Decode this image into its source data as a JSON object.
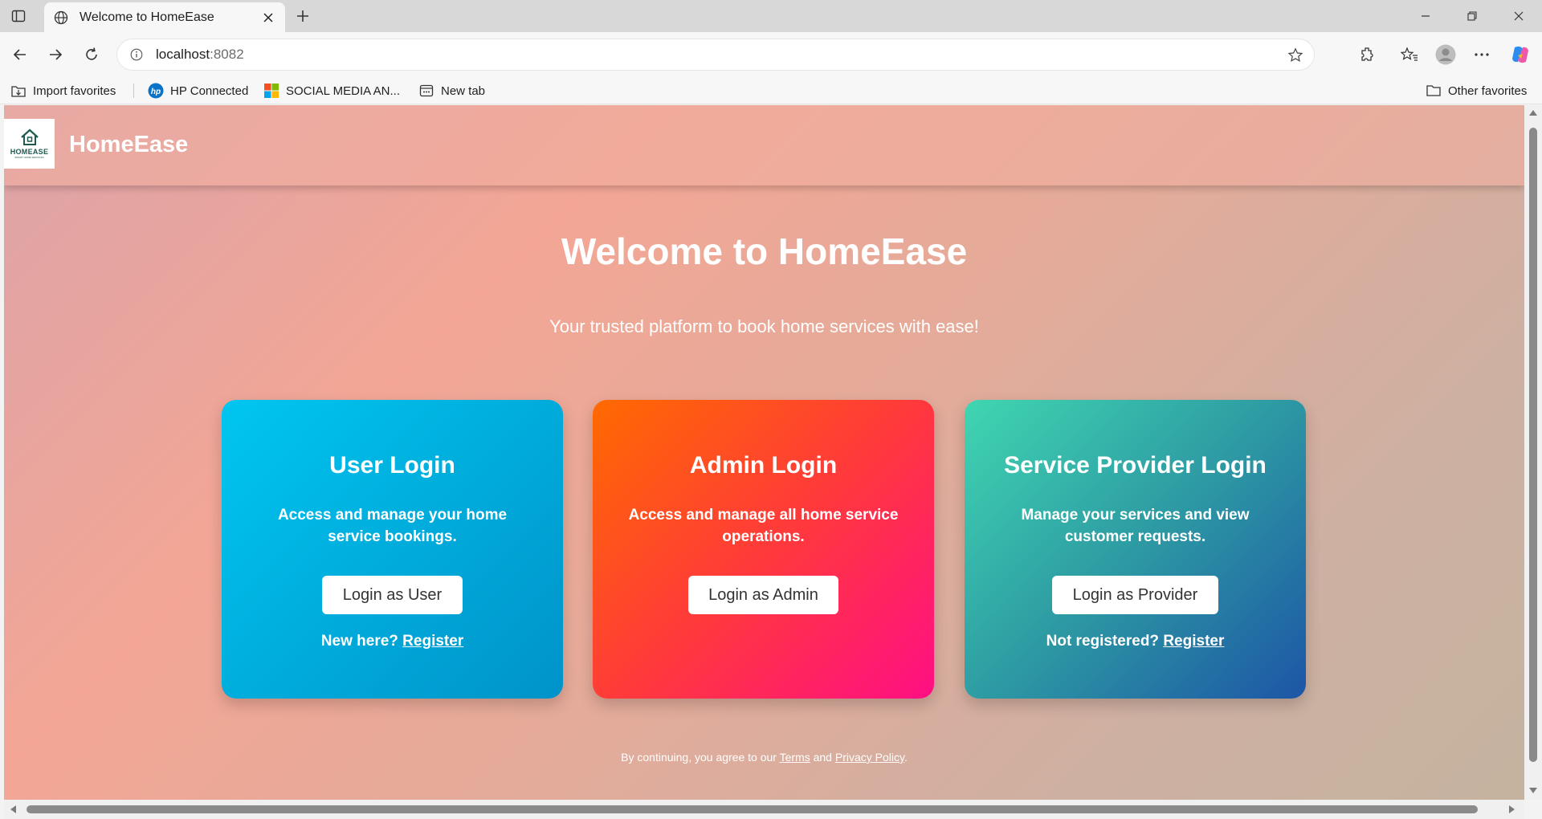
{
  "browser": {
    "tab_title": "Welcome to HomeEase",
    "url_host": "localhost",
    "url_port": ":8082",
    "favorites": [
      {
        "label": "Import favorites",
        "icon": "import-favorites-icon"
      },
      {
        "label": "HP Connected",
        "icon": "hp-icon"
      },
      {
        "label": "SOCIAL MEDIA AN...",
        "icon": "microsoft-icon"
      },
      {
        "label": "New tab",
        "icon": "new-tab-icon"
      }
    ],
    "other_favorites": "Other favorites"
  },
  "header": {
    "logo_text": "HOMEASE",
    "logo_subtext": "SMART HOME SERVICES",
    "brand": "HomeEase"
  },
  "hero": {
    "title": "Welcome to HomeEase",
    "subtitle": "Your trusted platform to book home services with ease!"
  },
  "cards": [
    {
      "title": "User Login",
      "description": "Access and manage your home service bookings.",
      "button": "Login as User",
      "footer_text": "New here? ",
      "footer_link": "Register"
    },
    {
      "title": "Admin Login",
      "description": "Access and manage all home service operations.",
      "button": "Login as Admin"
    },
    {
      "title": "Service Provider Login",
      "description": "Manage your services and view customer requests.",
      "button": "Login as Provider",
      "footer_text": "Not registered? ",
      "footer_link": "Register"
    }
  ],
  "footer": {
    "prefix": "By continuing, you agree to our ",
    "terms": "Terms",
    "and": " and ",
    "privacy": "Privacy Policy",
    "suffix": "."
  },
  "colors": {
    "user_card": "#00b4e0",
    "admin_card": "#ff3a3a",
    "provider_card": "#2d9aa3",
    "logo_green": "#1d5a50"
  }
}
